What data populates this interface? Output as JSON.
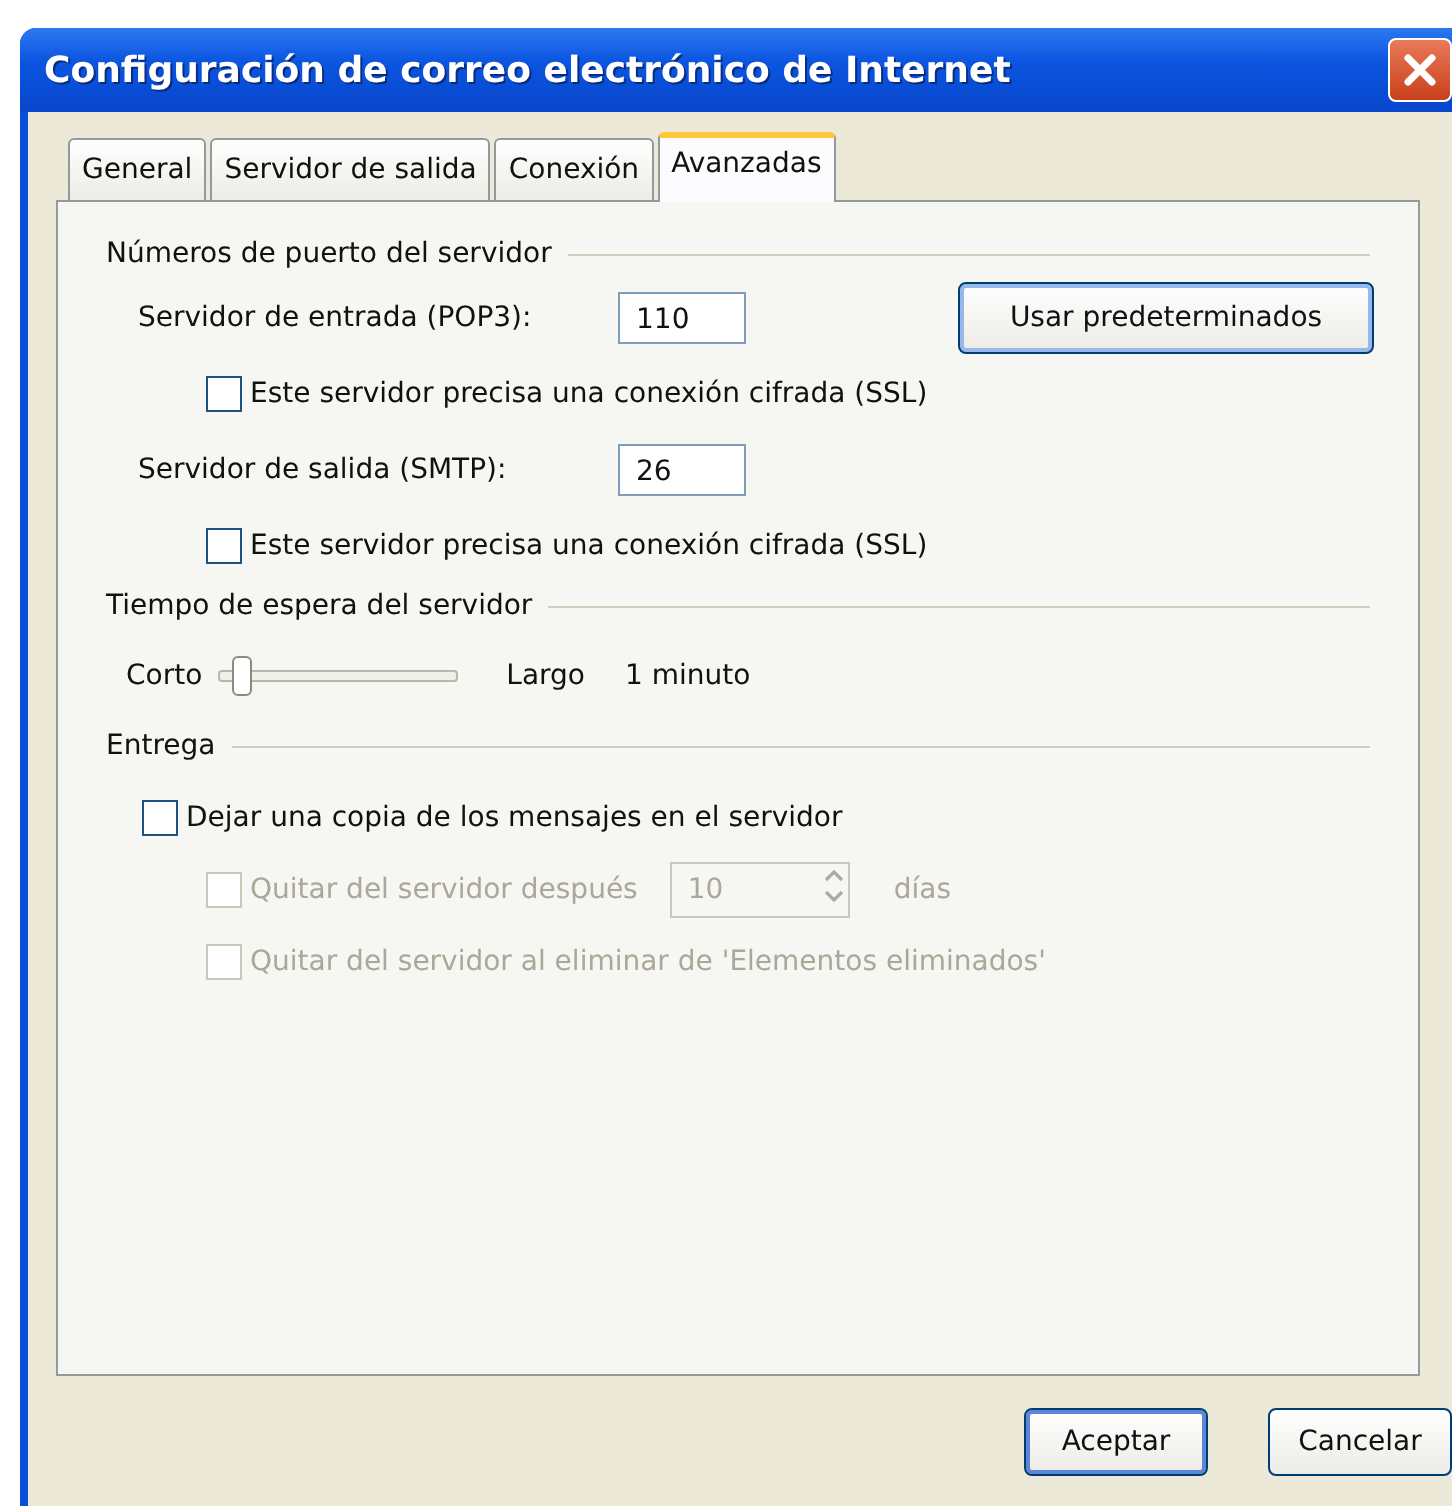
{
  "window": {
    "title": "Configuración de correo electrónico de Internet"
  },
  "tabs": [
    {
      "label": "General",
      "selected": false
    },
    {
      "label": "Servidor de salida",
      "selected": false
    },
    {
      "label": "Conexión",
      "selected": false
    },
    {
      "label": "Avanzadas",
      "selected": true
    }
  ],
  "ports": {
    "heading": "Números de puerto del servidor",
    "incoming": {
      "label": "Servidor de entrada (POP3):",
      "value": "110",
      "ssl": {
        "label": "Este servidor precisa una conexión cifrada (SSL)",
        "checked": false
      }
    },
    "defaults_button": "Usar predeterminados",
    "outgoing": {
      "label": "Servidor de salida (SMTP):",
      "value": "26",
      "ssl": {
        "label": "Este servidor precisa una conexión cifrada (SSL)",
        "checked": false
      }
    }
  },
  "timeout": {
    "heading": "Tiempo de espera del servidor",
    "min_label": "Corto",
    "max_label": "Largo",
    "level": 0.05,
    "reading": "1 minuto"
  },
  "delivery": {
    "heading": "Entrega",
    "leave_copy": {
      "label": "Dejar una copia de los mensajes en el servidor",
      "checked": false,
      "disabled": false
    },
    "remove_after": {
      "label": "Quitar del servidor después",
      "checked": false,
      "disabled": true,
      "value": "10",
      "unit": "días"
    },
    "remove_deleted": {
      "label": "Quitar del servidor al eliminar de 'Elementos eliminados'",
      "checked": false,
      "disabled": true
    }
  },
  "buttons": [
    {
      "label": "Aceptar",
      "default": true
    },
    {
      "label": "Cancelar",
      "default": false
    }
  ]
}
